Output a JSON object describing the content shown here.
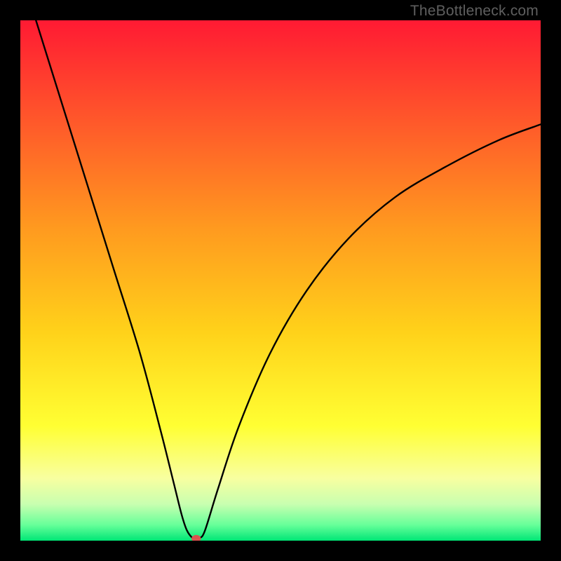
{
  "watermark": "TheBottleneck.com",
  "chart_data": {
    "type": "line",
    "title": "",
    "xlabel": "",
    "ylabel": "",
    "xlim": [
      0,
      100
    ],
    "ylim": [
      0,
      100
    ],
    "grid": false,
    "legend": false,
    "background_gradient": {
      "stops": [
        {
          "pos": 0.0,
          "color": "#ff1a33"
        },
        {
          "pos": 0.2,
          "color": "#ff5a2a"
        },
        {
          "pos": 0.4,
          "color": "#ff9a1f"
        },
        {
          "pos": 0.6,
          "color": "#ffd21a"
        },
        {
          "pos": 0.78,
          "color": "#ffff33"
        },
        {
          "pos": 0.88,
          "color": "#f8ffa0"
        },
        {
          "pos": 0.93,
          "color": "#c8ffb0"
        },
        {
          "pos": 0.97,
          "color": "#66ff99"
        },
        {
          "pos": 1.0,
          "color": "#00e676"
        }
      ]
    },
    "series": [
      {
        "name": "bottleneck-curve",
        "color": "#000000",
        "x": [
          3,
          8,
          13,
          18,
          23,
          27,
          29.5,
          31,
          32,
          33,
          33.8,
          34.5,
          35.5,
          38,
          42,
          48,
          55,
          63,
          72,
          82,
          92,
          100
        ],
        "y": [
          100,
          84,
          68,
          52,
          36,
          21,
          11,
          5,
          2,
          0.6,
          0.3,
          0.5,
          2,
          10,
          22,
          36,
          48,
          58,
          66,
          72,
          77,
          80
        ]
      }
    ],
    "marker": {
      "name": "min-point",
      "x": 33.8,
      "y": 0.4,
      "rx": 0.9,
      "ry": 0.7,
      "color": "#d9534f"
    }
  }
}
